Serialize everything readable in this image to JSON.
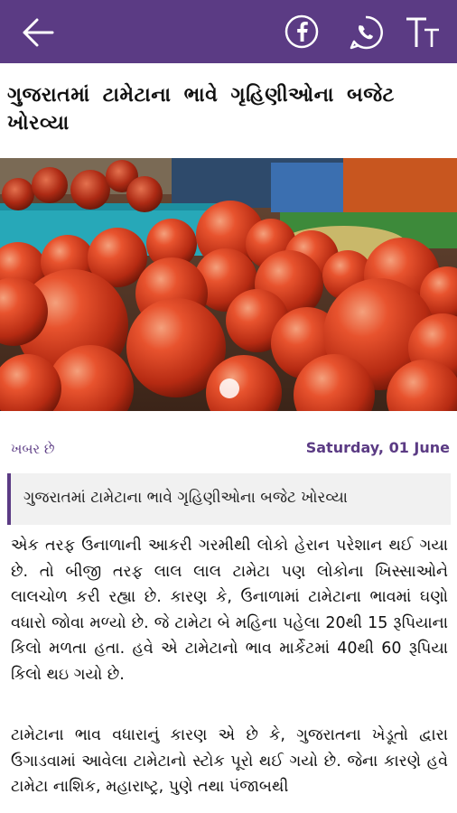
{
  "app": {
    "bar_color": "#5b3b84",
    "icons": {
      "back": "back-arrow-icon",
      "facebook": "facebook-icon",
      "whatsapp": "whatsapp-icon",
      "font_size": "font-size-icon"
    }
  },
  "article": {
    "headline": "ગુજરાતમાં  ટામેટાના ભાવે ગૃહિણીઓના  બજેટ ખોરવ્યા",
    "category": "ખબર છે",
    "date": "Saturday, 01 June",
    "summary": "ગુજરાતમાં ટામેટાના ભાવે ગૃહિણીઓના બજેટ ખોરવ્યા",
    "paragraphs": [
      "એક તરફ ઉનાળાની આકરી ગરમીથી લોકો હેરાન પરેશાન થઈ ગયા છે. તો બીજી તરફ લાલ લાલ ટામેટા પણ લોકોના ખિસ્સાઓને લાલચોળ કરી રહ્યા છે. કારણ કે, ઉનાળામાં ટામેટાના ભાવમાં ઘણો વધારો જોવા મળ્યો છે. જે ટામેટા બે મહિના પહેલા 20થી 15 રૂપિયાના કિલો મળતા હતા. હવે એ ટામેટાનો ભાવ માર્કેટમાં 40થી 60 રૂપિયા કિલો થઇ ગયો છે.",
      "ટામેટાના ભાવ વધારાનું કારણ એ છે કે, ગુજરાતના ખેડૂતો દ્વારા ઉગાડવામાં આવેલા ટામેટાનો સ્ટોક પૂરો થઈ ગયો છે. જેના કારણે હવે ટામેટા નાશિક, મહારાષ્ટ્ર, પુણે તથા પંજાબથી"
    ]
  }
}
